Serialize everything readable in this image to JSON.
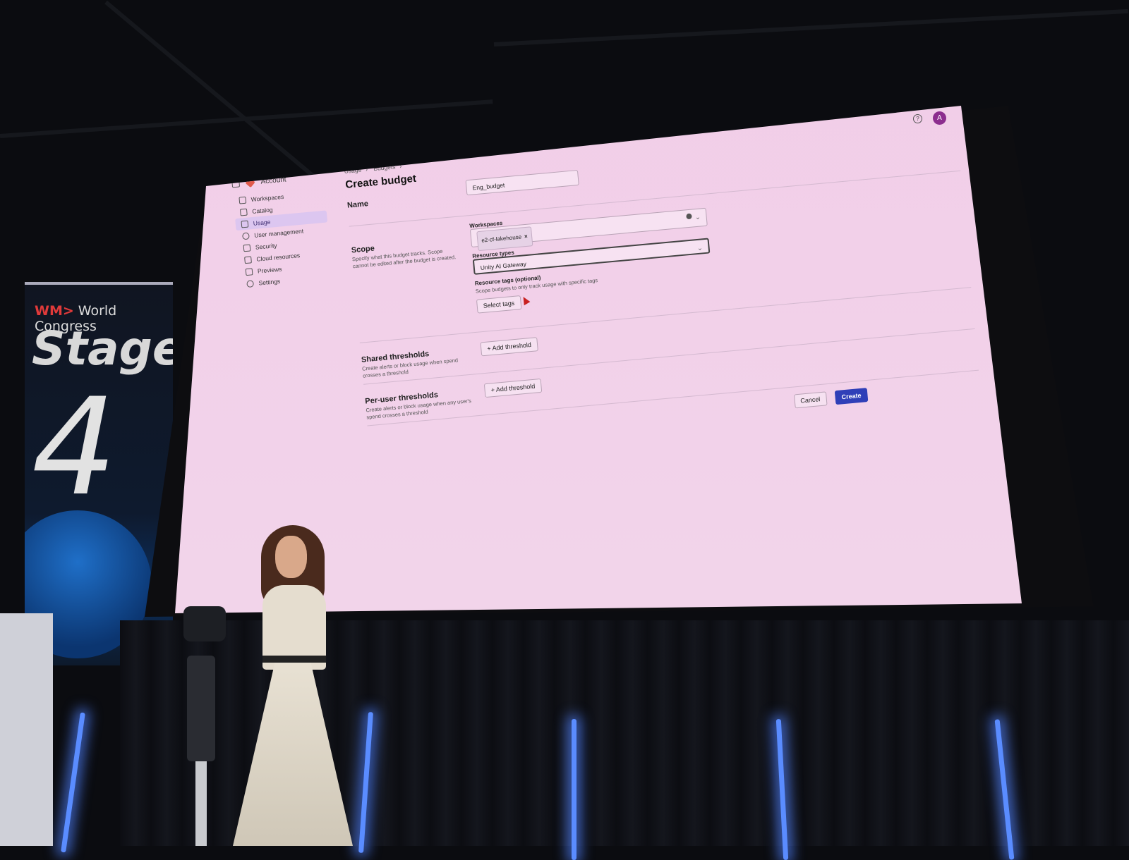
{
  "venue": {
    "banner_brand": "World Congress",
    "banner_stage": "Stage",
    "banner_number": "4"
  },
  "app": {
    "topbar": {
      "help_icon": "help-icon",
      "avatar_initial": "A"
    },
    "sidebar": {
      "account_label": "Account",
      "items": [
        {
          "label": "Workspaces",
          "icon": "workspaces-icon",
          "active": false
        },
        {
          "label": "Catalog",
          "icon": "catalog-icon",
          "active": false
        },
        {
          "label": "Usage",
          "icon": "usage-icon",
          "active": true
        },
        {
          "label": "User management",
          "icon": "user-management-icon",
          "active": false
        },
        {
          "label": "Security",
          "icon": "shield-icon",
          "active": false
        },
        {
          "label": "Cloud resources",
          "icon": "cloud-resources-icon",
          "active": false
        },
        {
          "label": "Previews",
          "icon": "previews-icon",
          "active": false
        },
        {
          "label": "Settings",
          "icon": "gear-icon",
          "active": false
        }
      ]
    },
    "breadcrumb": [
      "Usage",
      "Budgets"
    ],
    "page_title": "Create budget",
    "form": {
      "name_label": "Name",
      "name_value": "Eng_budget",
      "scope_label": "Scope",
      "scope_desc": "Specify what this budget tracks. Scope cannot be edited after the budget is created.",
      "workspaces_label": "Workspaces",
      "workspace_chip": "e2-cf-lakehouse",
      "resource_types_label": "Resource types",
      "resource_types_value": "Unity AI Gateway",
      "resource_tags_label": "Resource tags (optional)",
      "resource_tags_desc": "Scope budgets to only track usage with specific tags",
      "select_tags_button": "Select tags",
      "shared_label": "Shared thresholds",
      "shared_desc": "Create alerts or block usage when spend crosses a threshold",
      "per_user_label": "Per-user thresholds",
      "per_user_desc": "Create alerts or block usage when any user's spend crosses a threshold",
      "add_threshold_button": "Add threshold",
      "cancel_button": "Cancel",
      "create_button": "Create"
    },
    "colors": {
      "primary": "#2f3fb8",
      "active_nav": "#dcc6f0",
      "screen_bg": "#f1cde8"
    }
  }
}
